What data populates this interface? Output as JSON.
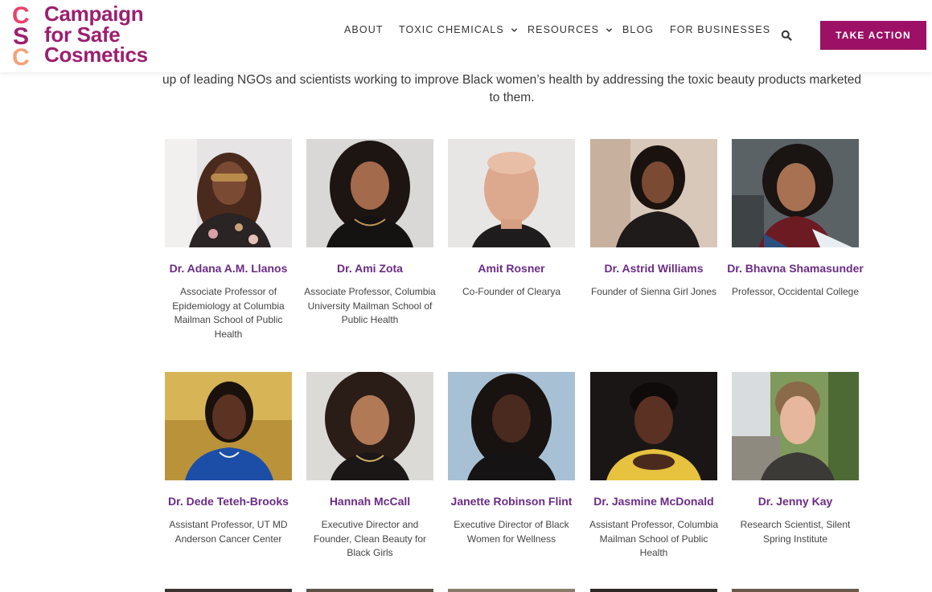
{
  "logo": {
    "letters": [
      "C",
      "S",
      "C"
    ],
    "lines": [
      "Campaign",
      "for Safe",
      "Cosmetics"
    ],
    "colors": {
      "c1": "#e8426a",
      "s": "#9c1f6f",
      "c2": "#f2a27b"
    }
  },
  "nav": {
    "items": [
      {
        "label": "ABOUT",
        "has_dropdown": false
      },
      {
        "label": "TOXIC CHEMICALS",
        "has_dropdown": true
      },
      {
        "label": "RESOURCES",
        "has_dropdown": true
      },
      {
        "label": "BLOG",
        "has_dropdown": false
      },
      {
        "label": "FOR BUSINESSES",
        "has_dropdown": false
      }
    ],
    "search_icon": "search-icon",
    "cta_label": "TAKE ACTION",
    "cta_color": "#9c1165"
  },
  "intro": {
    "text": "up of leading NGOs and scientists working to improve Black women’s health by addressing the toxic beauty products marketed to them."
  },
  "members": [
    {
      "name": "Dr. Adana A.M. Llanos",
      "role": "Associate Professor of Epidemiology at Columbia Mailman School of Public Health"
    },
    {
      "name": "Dr. Ami Zota",
      "role": "Associate Professor, Columbia University Mailman School of Public Health"
    },
    {
      "name": "Amit Rosner",
      "role": "Co-Founder of Clearya"
    },
    {
      "name": "Dr. Astrid Williams",
      "role": "Founder of Sienna Girl Jones"
    },
    {
      "name": "Dr. Bhavna Shamasunder",
      "role": "Professor, Occidental College"
    },
    {
      "name": "Dr. Dede Teteh-Brooks",
      "role": "Assistant Professor, UT MD Anderson Cancer Center"
    },
    {
      "name": "Hannah McCall",
      "role": "Executive Director and Founder, Clean Beauty for Black Girls"
    },
    {
      "name": "Janette Robinson Flint",
      "role": "Executive Director of Black Women for Wellness"
    },
    {
      "name": "Dr. Jasmine McDonald",
      "role": "Assistant Professor, Columbia Mailman School of Public Health"
    },
    {
      "name": "Dr. Jenny Kay",
      "role": "Research Scientist, Silent Spring Institute"
    }
  ],
  "colors": {
    "accent": "#9c1165",
    "name_color": "#6a2c85",
    "brand": "#9c1f6f"
  }
}
